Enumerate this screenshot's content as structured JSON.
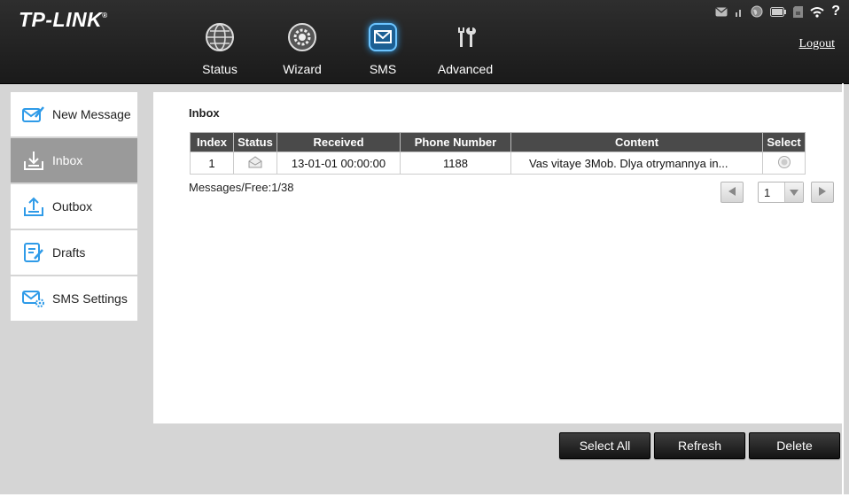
{
  "brand": {
    "logo": "TP-LINK",
    "mark": "®"
  },
  "nav": [
    {
      "label": "Status",
      "icon": "globe-icon"
    },
    {
      "label": "Wizard",
      "icon": "gear-icon"
    },
    {
      "label": "SMS",
      "icon": "envelope-icon",
      "active": true
    },
    {
      "label": "Advanced",
      "icon": "tools-icon"
    }
  ],
  "logout_label": "Logout",
  "status_bar": {
    "icons": [
      "message-icon",
      "signal-icon",
      "globe-icon",
      "battery-icon",
      "sim-card-icon",
      "wifi-icon",
      "help-icon"
    ],
    "help_text": "?"
  },
  "sidebar": {
    "items": [
      {
        "label": "New Message",
        "icon": "new-message-icon"
      },
      {
        "label": "Inbox",
        "icon": "inbox-icon",
        "active": true
      },
      {
        "label": "Outbox",
        "icon": "outbox-icon"
      },
      {
        "label": "Drafts",
        "icon": "drafts-icon"
      },
      {
        "label": "SMS Settings",
        "icon": "sms-settings-icon"
      }
    ]
  },
  "inbox": {
    "title": "Inbox",
    "columns": [
      "Index",
      "Status",
      "Received",
      "Phone Number",
      "Content",
      "Select"
    ],
    "rows": [
      {
        "index": "1",
        "status_icon": "opened-envelope-icon",
        "received": "13-01-01 00:00:00",
        "phone": "1188",
        "content": "Vas vitaye 3Mob. Dlya otrymannya in..."
      }
    ],
    "messages_free": "Messages/Free:1/38",
    "page_value": "1"
  },
  "buttons": {
    "select_all": "Select All",
    "refresh": "Refresh",
    "delete": "Delete"
  },
  "colors": {
    "header_bg": "#222222",
    "accent_blue": "#2f9be8",
    "sidebar_active": "#9a9a9a",
    "button_bg": "#1e1e1e"
  }
}
